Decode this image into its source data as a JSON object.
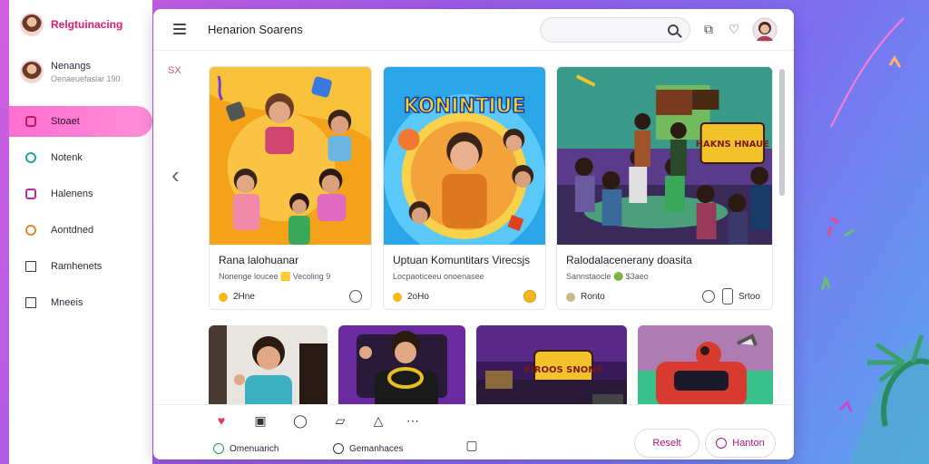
{
  "sidebar": {
    "brand": "Relgtuinacing",
    "profile": {
      "name": "Nenangs",
      "subtitle": "Oenaeuefaslar 190"
    },
    "items": [
      {
        "label": "Stoaet",
        "icon": "home-icon"
      },
      {
        "label": "Notenk",
        "icon": "chat-icon"
      },
      {
        "label": "Halenens",
        "icon": "camera-icon"
      },
      {
        "label": "Aontdned",
        "icon": "search-icon"
      },
      {
        "label": "Ramhenets",
        "icon": "card-icon"
      },
      {
        "label": "Mneeis",
        "icon": "book-icon"
      }
    ]
  },
  "header": {
    "title": "Henarion Soarens",
    "search_placeholder": "",
    "icons": [
      "search-icon",
      "share-icon",
      "heart-icon",
      "avatar"
    ]
  },
  "side_mark": "SX",
  "cards": [
    {
      "title": "Rana lalohuanar",
      "meta": "Nonenge loucee 🟨 Vecoling 9",
      "stat": "2Hne",
      "end_icon": "clock-icon"
    },
    {
      "title": "Uptuan Komuntitars Virecsjs",
      "meta": "Locpaoticeeu onoenasee",
      "stat": "2oHo",
      "end_icon": "coin-icon"
    },
    {
      "title": "Ralodalacenerany doasita",
      "meta": "Sannstaocle 🟢 $3aeo",
      "stat": "Ronto",
      "end_icon": "clock-icon",
      "extra": "Srtoo"
    }
  ],
  "card_art_text": {
    "card2": "KONINTIUE",
    "card3": "HAKNS HNAUE"
  },
  "thumbs_art_text": {
    "thumb3": "FIROOS SNONS"
  },
  "bottom": {
    "icons": [
      "heart-icon",
      "calendar-icon",
      "chat-icon",
      "note-icon",
      "bell-icon",
      "more-icon",
      "square-icon"
    ],
    "label_left": "Omenuarich",
    "label_mid": "Gemanhaces",
    "btn_primary": "Reselt",
    "btn_secondary": "Hanton"
  },
  "colors": {
    "accent": "#ff6fcf",
    "brand_text": "#e21a6e"
  }
}
